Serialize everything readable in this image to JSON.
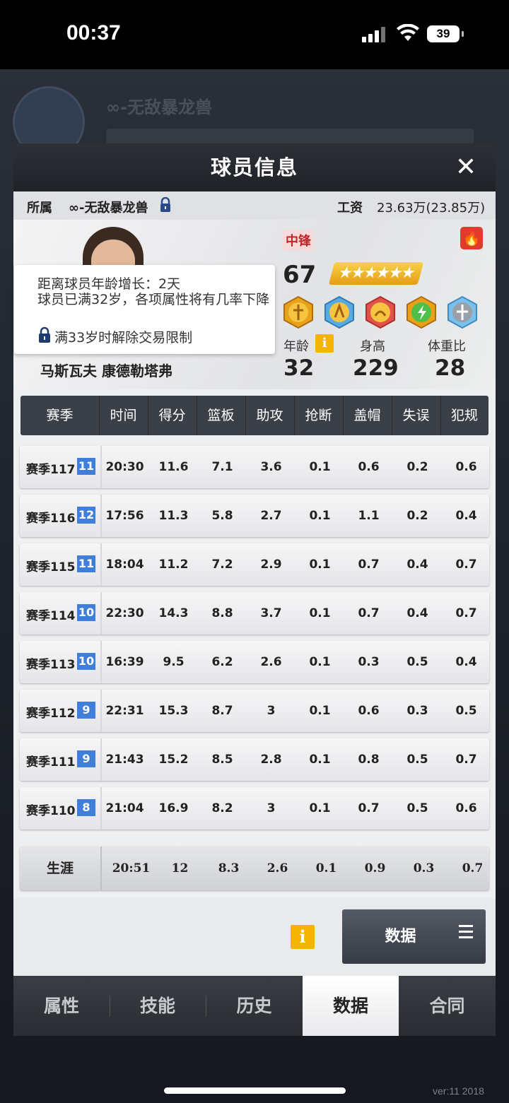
{
  "status_bar": {
    "time": "00:37",
    "battery": "39"
  },
  "panel": {
    "title": "球员信息",
    "close_icon": "close-icon",
    "team_label": "所属",
    "team_name": "∞-无敌暴龙兽",
    "salary_label": "工资",
    "salary_value": "23.63万(23.85万)"
  },
  "player": {
    "name": "马斯瓦夫 康德勒塔弗",
    "position": "中锋",
    "rating": "67",
    "stars_shown": "5.5 stars",
    "age_label": "年龄",
    "age": "32",
    "height_label": "身高",
    "height": "229",
    "weight_label": "体重比",
    "weight": "28",
    "badges": [
      "post-badge",
      "shooting-badge",
      "feet-badge",
      "energy-badge",
      "defense-badge"
    ],
    "tooltip": {
      "line1": "距离球员年龄增长：2天",
      "line2": "球员已满32岁，各项属性将有几率下降",
      "line3": "满33岁时解除交易限制"
    }
  },
  "table": {
    "headers": [
      "赛季",
      "时间",
      "得分",
      "篮板",
      "助攻",
      "抢断",
      "盖帽",
      "失误",
      "犯规"
    ],
    "rows": [
      {
        "season": "赛季117",
        "num": "11",
        "vals": [
          "20:30",
          "11.6",
          "7.1",
          "3.6",
          "0.1",
          "0.6",
          "0.2",
          "0.6"
        ]
      },
      {
        "season": "赛季116",
        "num": "12",
        "vals": [
          "17:56",
          "11.3",
          "5.8",
          "2.7",
          "0.1",
          "1.1",
          "0.2",
          "0.4"
        ]
      },
      {
        "season": "赛季115",
        "num": "11",
        "vals": [
          "18:04",
          "11.2",
          "7.2",
          "2.9",
          "0.1",
          "0.7",
          "0.4",
          "0.7"
        ]
      },
      {
        "season": "赛季114",
        "num": "10",
        "vals": [
          "22:30",
          "14.3",
          "8.8",
          "3.7",
          "0.1",
          "0.7",
          "0.4",
          "0.7"
        ]
      },
      {
        "season": "赛季113",
        "num": "10",
        "vals": [
          "16:39",
          "9.5",
          "6.2",
          "2.6",
          "0.1",
          "0.3",
          "0.5",
          "0.4"
        ]
      },
      {
        "season": "赛季112",
        "num": "9",
        "vals": [
          "22:31",
          "15.3",
          "8.7",
          "3",
          "0.1",
          "0.6",
          "0.3",
          "0.5"
        ]
      },
      {
        "season": "赛季111",
        "num": "9",
        "vals": [
          "21:43",
          "15.2",
          "8.5",
          "2.8",
          "0.1",
          "0.8",
          "0.5",
          "0.7"
        ]
      },
      {
        "season": "赛季110",
        "num": "8",
        "vals": [
          "21:04",
          "16.9",
          "8.2",
          "3",
          "0.1",
          "0.7",
          "0.5",
          "0.6"
        ]
      }
    ],
    "career": {
      "label": "生涯",
      "vals": [
        "20:51",
        "12",
        "8.3",
        "2.6",
        "0.1",
        "0.9",
        "0.3",
        "0.7"
      ]
    }
  },
  "data_button": {
    "label": "数据"
  },
  "tabs": [
    "属性",
    "技能",
    "历史",
    "数据",
    "合同"
  ],
  "active_tab": "数据",
  "background": {
    "team_name": "∞-无敌暴龙兽",
    "version": "ver:11  2018"
  }
}
